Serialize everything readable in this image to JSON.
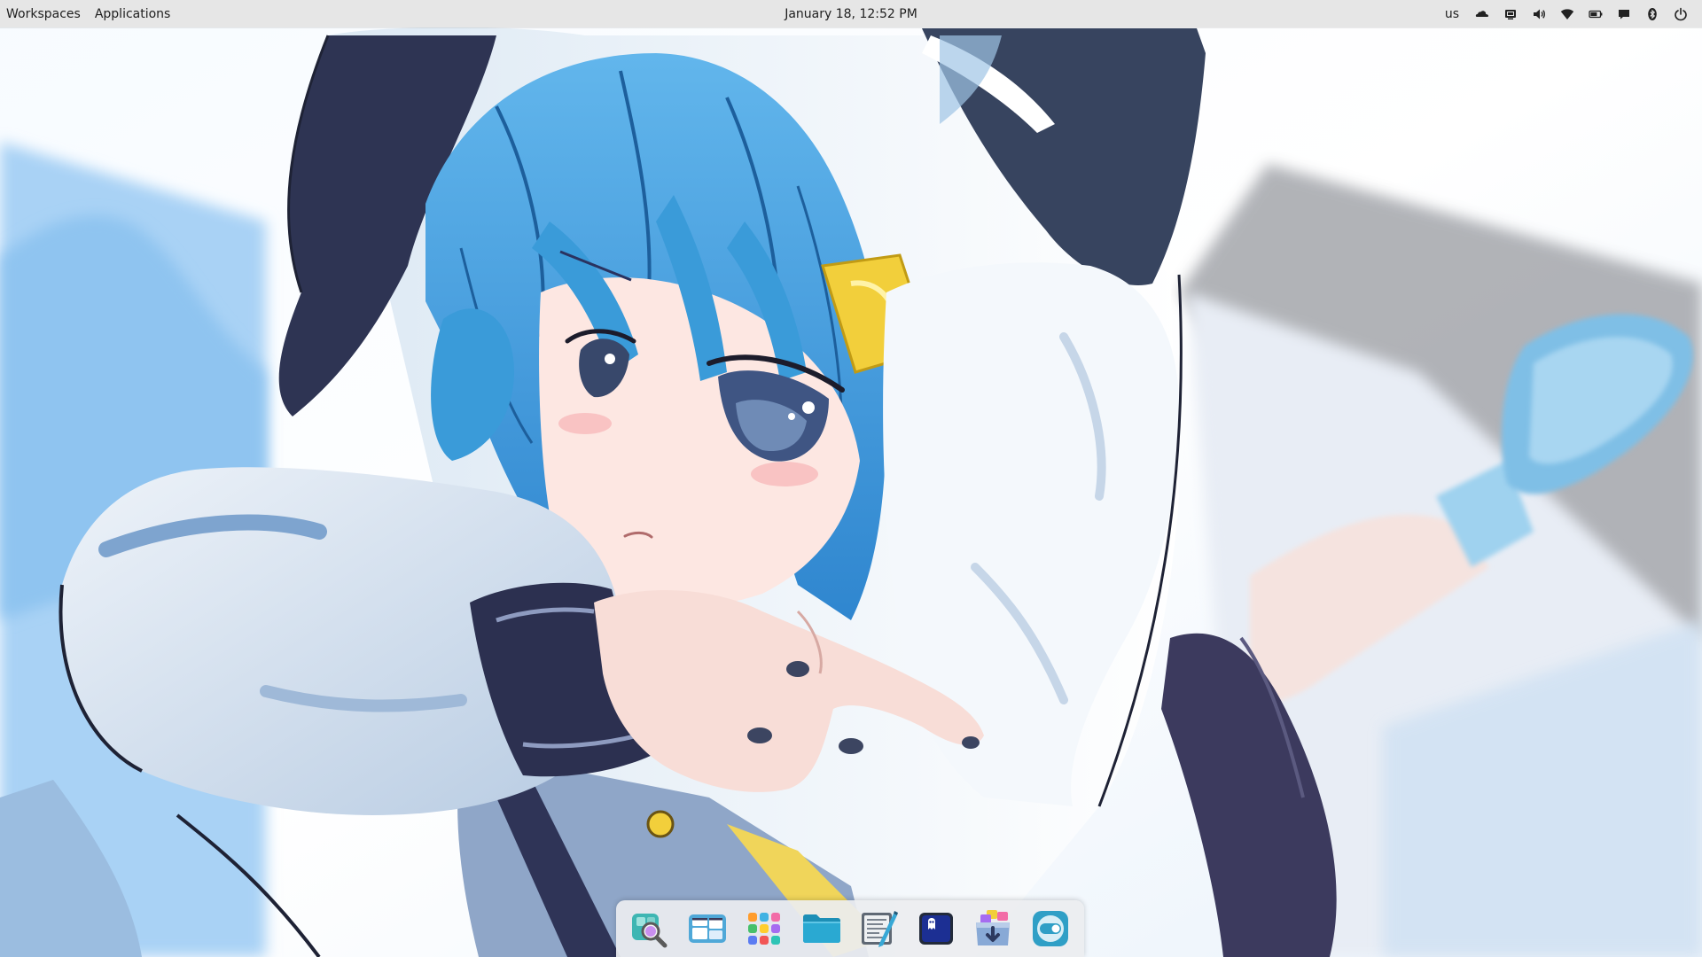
{
  "topbar": {
    "workspaces_label": "Workspaces",
    "applications_label": "Applications",
    "clock_text": "January 18, 12:52 PM",
    "keyboard_layout": "us",
    "tray_icons": [
      "cloud-icon",
      "screen-share-icon",
      "volume-icon",
      "wifi-icon",
      "battery-icon",
      "notifications-icon",
      "bluetooth-icon",
      "power-icon"
    ]
  },
  "dock": {
    "items": [
      {
        "name": "search-app",
        "icon": "magnifier-icon"
      },
      {
        "name": "multitasking-view",
        "icon": "windows-overview-icon"
      },
      {
        "name": "app-grid",
        "icon": "app-grid-icon"
      },
      {
        "name": "files",
        "icon": "folder-icon"
      },
      {
        "name": "text-editor",
        "icon": "text-editor-icon"
      },
      {
        "name": "terminal",
        "icon": "terminal-icon"
      },
      {
        "name": "app-center",
        "icon": "package-download-icon"
      },
      {
        "name": "settings",
        "icon": "toggle-settings-icon"
      }
    ]
  },
  "colors": {
    "topbar_bg": "#e6e6e6",
    "dock_bg": "#ebedf0",
    "wallpaper_sky": "#9ccbf2",
    "hair_blue": "#3a9bd9"
  }
}
